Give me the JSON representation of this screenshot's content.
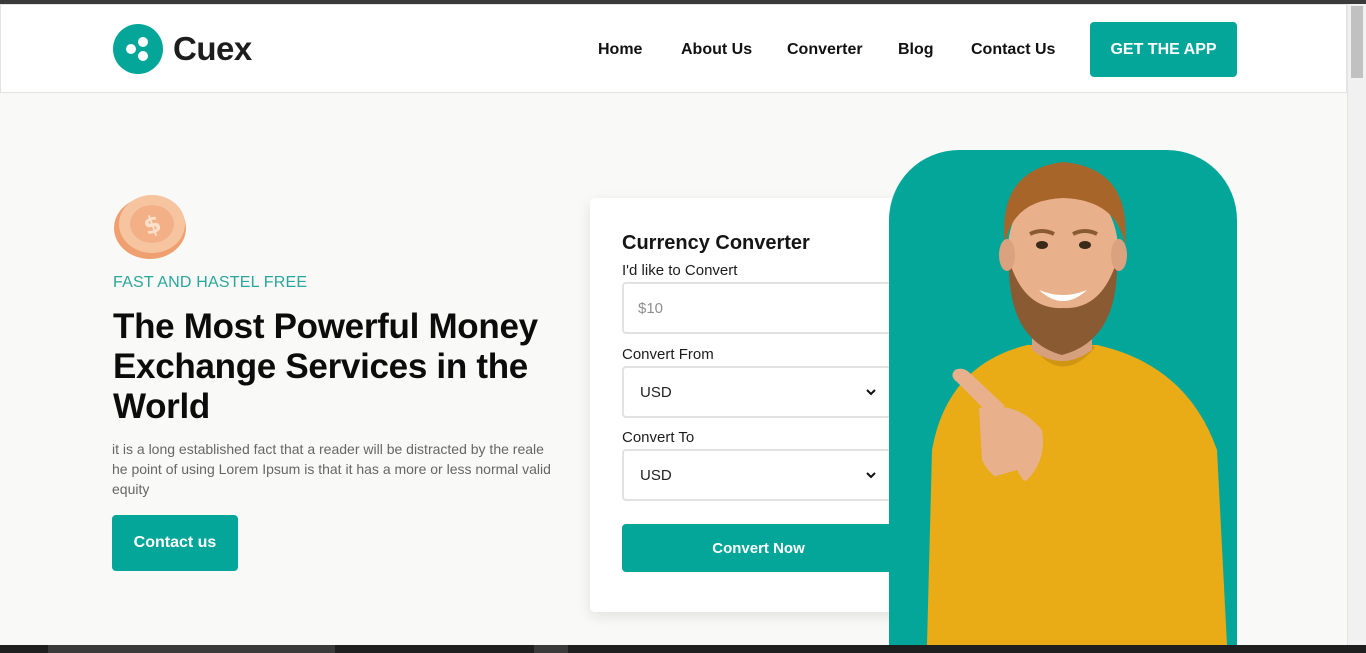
{
  "brand": {
    "name": "Cuex",
    "accent": "#04a69a"
  },
  "nav": {
    "items": [
      "Home",
      "About Us",
      "Converter",
      "Blog",
      "Contact Us"
    ],
    "cta": "GET THE APP"
  },
  "hero": {
    "tagline": "FAST AND HASTEL FREE",
    "headline": "The Most Powerful Money Exchange Services in the World",
    "description": "it is a long established fact that a reader will be distracted by the reale he point of using Lorem Ipsum is that it has a more or less normal valid equity",
    "button": "Contact us"
  },
  "converter": {
    "title": "Currency Converter",
    "amount_label": "I'd like to Convert",
    "amount_placeholder": "$10",
    "from_label": "Convert From",
    "from_value": "USD",
    "to_label": "Convert To",
    "to_value": "USD",
    "button": "Convert Now"
  },
  "icons": {
    "logo": "ripple-logo-icon",
    "coin": "dollar-coin-icon",
    "select": "chevron-down-icon"
  }
}
